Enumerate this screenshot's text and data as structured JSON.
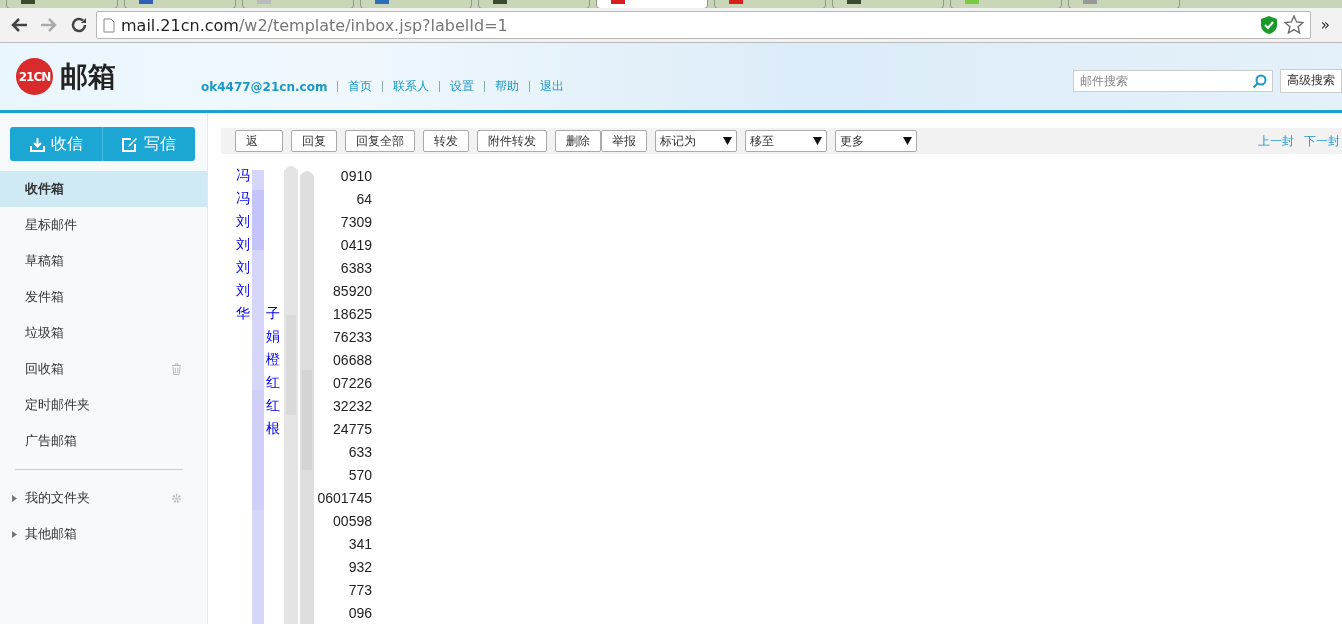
{
  "browser": {
    "tabs": [
      {
        "selected": false,
        "color": "#3b4a30"
      },
      {
        "selected": false,
        "color": "#2d5fb8"
      },
      {
        "selected": false,
        "color": "#bbbbbb"
      },
      {
        "selected": false,
        "color": "#2d6fb8"
      },
      {
        "selected": false,
        "color": "#3b4a30"
      },
      {
        "selected": true,
        "color": "#d62020"
      },
      {
        "selected": false,
        "color": "#d62020"
      },
      {
        "selected": false,
        "color": "#3b4a30"
      },
      {
        "selected": false,
        "color": "#7ac943"
      },
      {
        "selected": false,
        "color": "#999999"
      }
    ],
    "url_host": "mail.21cn.com",
    "url_path": "/w2/template/inbox.jsp?labelId=1",
    "overflow": "»"
  },
  "header": {
    "logo_badge": "21CN",
    "logo_text": "邮箱",
    "account": "ok4477@21cn.com",
    "nav": [
      "首页",
      "联系人",
      "设置",
      "帮助",
      "退出"
    ],
    "search_placeholder": "邮件搜索",
    "advanced_search": "高级搜索"
  },
  "sidebar": {
    "receive": "收信",
    "compose": "写信",
    "folders": [
      {
        "label": "收件箱",
        "selected": true,
        "kind": "plain"
      },
      {
        "label": "星标邮件",
        "selected": false,
        "kind": "plain"
      },
      {
        "label": "草稿箱",
        "selected": false,
        "kind": "plain"
      },
      {
        "label": "发件箱",
        "selected": false,
        "kind": "plain"
      },
      {
        "label": "垃圾箱",
        "selected": false,
        "kind": "plain"
      },
      {
        "label": "回收箱",
        "selected": false,
        "kind": "trash"
      },
      {
        "label": "定时邮件夹",
        "selected": false,
        "kind": "plain"
      },
      {
        "label": "广告邮箱",
        "selected": false,
        "kind": "plain"
      }
    ],
    "groups": [
      {
        "label": "我的文件夹",
        "expanded": false,
        "kind": "settings"
      },
      {
        "label": "其他邮箱",
        "expanded": false,
        "kind": "plain"
      }
    ]
  },
  "toolbar": {
    "buttons": [
      [
        "返"
      ],
      [
        "回复"
      ],
      [
        "回复全部"
      ],
      [
        "转发"
      ],
      [
        "附件转发"
      ],
      [
        "删除",
        "举报"
      ]
    ],
    "selects": [
      "标记为",
      "移至",
      "更多"
    ],
    "prev": "上一封",
    "next": "下一封"
  },
  "message": {
    "rows": [
      {
        "name": "冯",
        "number": "0910"
      },
      {
        "name": "冯",
        "number": "64"
      },
      {
        "name": "刘",
        "number": "7309"
      },
      {
        "name": "刘",
        "number": "0419"
      },
      {
        "name": "刘",
        "number": "6383"
      },
      {
        "name": "刘",
        "number": "85920"
      },
      {
        "name": "华",
        "name_end": "子",
        "number": "18625"
      },
      {
        "name_end": "娟",
        "number": "76233"
      },
      {
        "name_end": "橙",
        "number": "06688"
      },
      {
        "name_end": "红",
        "number": "07226"
      },
      {
        "name_end": "红",
        "number": "32232"
      },
      {
        "name_end": "根",
        "number": "24775"
      },
      {
        "number": "633"
      },
      {
        "number": "570"
      },
      {
        "number": "0601745"
      },
      {
        "number": "00598"
      },
      {
        "number": "341"
      },
      {
        "number": "932"
      },
      {
        "number": "773"
      },
      {
        "number": "096"
      }
    ]
  }
}
